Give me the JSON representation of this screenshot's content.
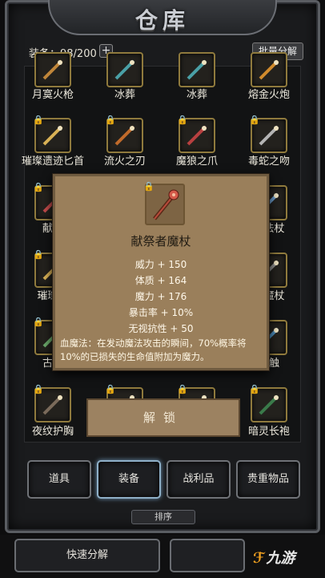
{
  "title": "仓库",
  "capacity": {
    "label": "装备：98/200",
    "add_symbol": "+"
  },
  "batch_decompose_label": "批量分解",
  "items": [
    {
      "name": "月寞火枪",
      "locked": false,
      "color": "#c0863a"
    },
    {
      "name": "冰葬",
      "locked": false,
      "color": "#4aa0a6"
    },
    {
      "name": "冰葬",
      "locked": false,
      "color": "#4aa0a6"
    },
    {
      "name": "熔金火炮",
      "locked": false,
      "color": "#d08a2c"
    },
    {
      "name": "璀璨遗迹匕首",
      "locked": true,
      "color": "#d9b155"
    },
    {
      "name": "流火之刃",
      "locked": true,
      "color": "#c06a2a"
    },
    {
      "name": "魔狼之爪",
      "locked": true,
      "color": "#b84040"
    },
    {
      "name": "毒蛇之吻",
      "locked": true,
      "color": "#b4b4b4"
    },
    {
      "name": "献祭",
      "locked": true,
      "color": "#c24a4a"
    },
    {
      "name": "迹法杖",
      "locked": true,
      "color": "#6a9ac8"
    },
    {
      "name": "璀璨遗",
      "locked": true,
      "color": "#d9b155"
    },
    {
      "name": "刺魔杖",
      "locked": true,
      "color": "#8a8a8a"
    },
    {
      "name": "古精",
      "locked": true,
      "color": "#6aa86a"
    },
    {
      "name": "之触",
      "locked": true,
      "color": "#4a8ab8"
    },
    {
      "name": "夜纹护胸",
      "locked": true,
      "color": "#7a6a5a"
    },
    {
      "name": "",
      "locked": true,
      "color": "#6a6a6a"
    },
    {
      "name": "",
      "locked": true,
      "color": "#6a6a6a"
    },
    {
      "name": "暗灵长袍",
      "locked": true,
      "color": "#3a7a4a"
    }
  ],
  "popup": {
    "item_name": "献祭者魔杖",
    "stats": [
      "威力 + 150",
      "体质 + 164",
      "魔力 + 176",
      "暴击率 + 10%",
      "无视抗性 + 50"
    ],
    "skill_text": "血魔法：在发动魔法攻击的瞬间，70%概率将10%的已损失的生命值附加为魔力。"
  },
  "unlock_label": "解锁",
  "tabs": [
    {
      "label": "道具",
      "active": false
    },
    {
      "label": "装备",
      "active": true
    },
    {
      "label": "战利品",
      "active": false
    },
    {
      "label": "贵重物品",
      "active": false
    }
  ],
  "sort_label": "排序",
  "quick_decompose_label": "快速分解",
  "watermark": "九游",
  "colors": {
    "popup_bg": "#9a7f5b",
    "slot_border": "#8f7a3d",
    "active_tab_glow": "#8fb0c8"
  }
}
